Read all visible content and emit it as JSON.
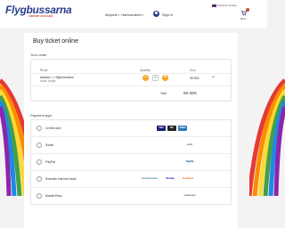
{
  "brand": {
    "name": "Flygbussarna",
    "tagline": "AIRPORT COACHES"
  },
  "nav": {
    "items": [
      {
        "label": "Airports"
      },
      {
        "label": "Harbours"
      },
      {
        "label": "Info"
      }
    ],
    "signin": "Sign in"
  },
  "lang": {
    "label": "Customer service"
  },
  "cart": {
    "count": "1",
    "total": "99 kr"
  },
  "page": {
    "title": "Buy ticket online"
  },
  "order": {
    "section_label": "Your order",
    "headers": {
      "route": "Route",
      "quantity": "Quantity",
      "sum": "Sum"
    },
    "item": {
      "route": "Arlanda <-> Stjärnhoweine",
      "sub": "Adult, single",
      "minus": "−",
      "plus": "+",
      "quantity": "1",
      "sum": "99 SEK",
      "remove": "×"
    },
    "total_label": "Total",
    "total_value": "99 SEK"
  },
  "payment": {
    "section_label": "Payment type",
    "options": [
      {
        "label": "Credit card",
        "badges": [
          "VISA",
          "MC",
          "AMEX"
        ]
      },
      {
        "label": "Swish",
        "badges": [
          "swish"
        ]
      },
      {
        "label": "PayPal",
        "badges": [
          "PayPal"
        ]
      },
      {
        "label": "Swedish internet bank",
        "badges": [
          "Handelsbanken",
          "Nordea",
          "Swedbank"
        ]
      },
      {
        "label": "MasterPass",
        "badges": [
          "masterpass"
        ]
      }
    ]
  },
  "colors": {
    "accent": "#f5a623",
    "brand": "#2a3f8a",
    "panel": "#ffffff",
    "background": "#f3f3f3"
  }
}
